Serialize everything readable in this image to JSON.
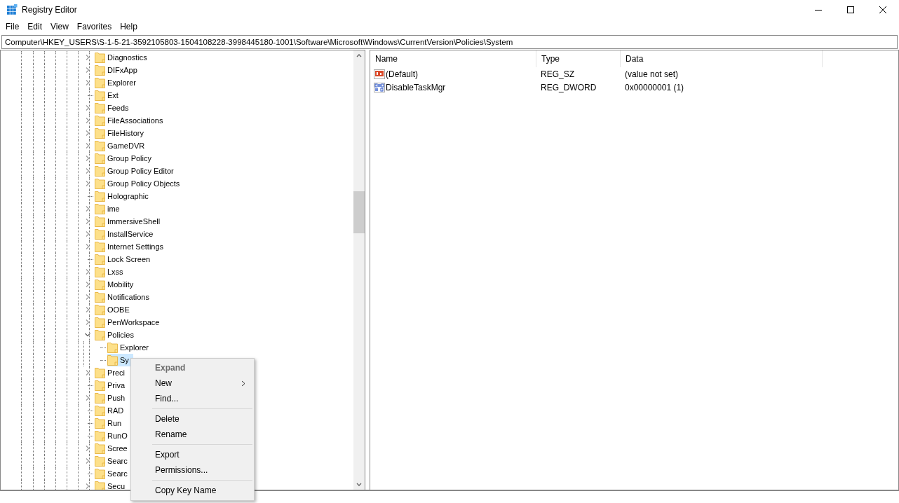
{
  "window": {
    "title": "Registry Editor"
  },
  "menu_bar": [
    "File",
    "Edit",
    "View",
    "Favorites",
    "Help"
  ],
  "address": "Computer\\HKEY_USERS\\S-1-5-21-3592105803-1504108228-3998445180-1001\\Software\\Microsoft\\Windows\\CurrentVersion\\Policies\\System",
  "tree": [
    {
      "label": "Diagnostics",
      "expandable": true,
      "selected": false
    },
    {
      "label": "DIFxApp",
      "expandable": true,
      "selected": false
    },
    {
      "label": "Explorer",
      "expandable": true,
      "selected": false
    },
    {
      "label": "Ext",
      "expandable": false,
      "selected": false
    },
    {
      "label": "Feeds",
      "expandable": true,
      "selected": false
    },
    {
      "label": "FileAssociations",
      "expandable": true,
      "selected": false
    },
    {
      "label": "FileHistory",
      "expandable": true,
      "selected": false
    },
    {
      "label": "GameDVR",
      "expandable": true,
      "selected": false
    },
    {
      "label": "Group Policy",
      "expandable": true,
      "selected": false
    },
    {
      "label": "Group Policy Editor",
      "expandable": true,
      "selected": false
    },
    {
      "label": "Group Policy Objects",
      "expandable": true,
      "selected": false
    },
    {
      "label": "Holographic",
      "expandable": false,
      "selected": false
    },
    {
      "label": "ime",
      "expandable": true,
      "selected": false
    },
    {
      "label": "ImmersiveShell",
      "expandable": true,
      "selected": false
    },
    {
      "label": "InstallService",
      "expandable": true,
      "selected": false
    },
    {
      "label": "Internet Settings",
      "expandable": true,
      "selected": false
    },
    {
      "label": "Lock Screen",
      "expandable": false,
      "selected": false
    },
    {
      "label": "Lxss",
      "expandable": true,
      "selected": false
    },
    {
      "label": "Mobility",
      "expandable": true,
      "selected": false
    },
    {
      "label": "Notifications",
      "expandable": true,
      "selected": false
    },
    {
      "label": "OOBE",
      "expandable": true,
      "selected": false
    },
    {
      "label": "PenWorkspace",
      "expandable": true,
      "selected": false
    },
    {
      "label": "Policies",
      "expandable": true,
      "expanded": true,
      "selected": false,
      "children": [
        {
          "label": "Explorer",
          "expandable": false,
          "selected": false
        },
        {
          "label": "Sy",
          "expandable": false,
          "selected": true
        }
      ]
    },
    {
      "label": "Preci",
      "expandable": true,
      "selected": false
    },
    {
      "label": "Priva",
      "expandable": false,
      "selected": false
    },
    {
      "label": "Push",
      "expandable": true,
      "selected": false
    },
    {
      "label": "RAD",
      "expandable": false,
      "selected": false
    },
    {
      "label": "Run",
      "expandable": false,
      "selected": false
    },
    {
      "label": "RunO",
      "expandable": false,
      "selected": false
    },
    {
      "label": "Scree",
      "expandable": true,
      "selected": false
    },
    {
      "label": "Searc",
      "expandable": true,
      "selected": false
    },
    {
      "label": "Searc",
      "expandable": false,
      "selected": false
    },
    {
      "label": "Secu",
      "expandable": true,
      "selected": false
    }
  ],
  "values": {
    "columns": [
      "Name",
      "Type",
      "Data"
    ],
    "rows": [
      {
        "kind": "string",
        "name": "(Default)",
        "type": "REG_SZ",
        "data": "(value not set)"
      },
      {
        "kind": "binary",
        "name": "DisableTaskMgr",
        "type": "REG_DWORD",
        "data": "0x00000001 (1)"
      }
    ]
  },
  "context_menu": {
    "groups": [
      [
        {
          "label": "Expand",
          "disabled": true,
          "default": true,
          "submenu": false
        },
        {
          "label": "New",
          "disabled": false,
          "default": false,
          "submenu": true
        },
        {
          "label": "Find...",
          "disabled": false,
          "default": false,
          "submenu": false
        }
      ],
      [
        {
          "label": "Delete",
          "disabled": false,
          "default": false,
          "submenu": false
        },
        {
          "label": "Rename",
          "disabled": false,
          "default": false,
          "submenu": false
        }
      ],
      [
        {
          "label": "Export",
          "disabled": false,
          "default": false,
          "submenu": false
        },
        {
          "label": "Permissions...",
          "disabled": false,
          "default": false,
          "submenu": false
        }
      ],
      [
        {
          "label": "Copy Key Name",
          "disabled": false,
          "default": false,
          "submenu": false
        }
      ]
    ]
  }
}
